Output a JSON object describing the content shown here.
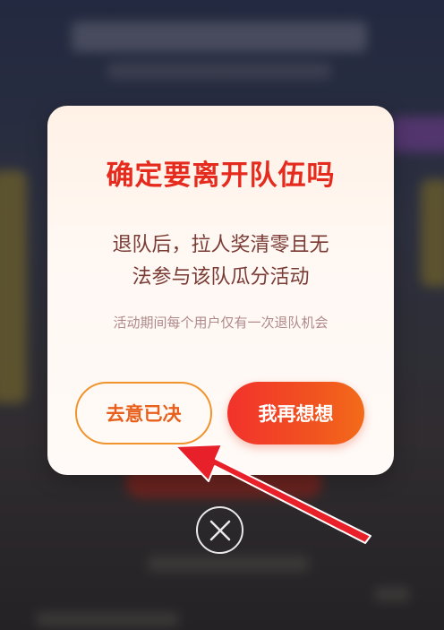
{
  "dialog": {
    "title": "确定要离开队伍吗",
    "body_line1": "退队后，拉人奖清零且无",
    "body_line2": "法参与该队瓜分活动",
    "note": "活动期间每个用户仅有一次退队机会",
    "leave_label": "去意已决",
    "stay_label": "我再想想"
  },
  "icons": {
    "close": "close-icon",
    "arrow": "pointer-arrow-icon"
  },
  "colors": {
    "title": "#e52b1e",
    "accent_orange": "#f0932c",
    "primary_gradient_start": "#f2322c",
    "primary_gradient_end": "#f36b1a",
    "arrow": "#e8202a"
  }
}
